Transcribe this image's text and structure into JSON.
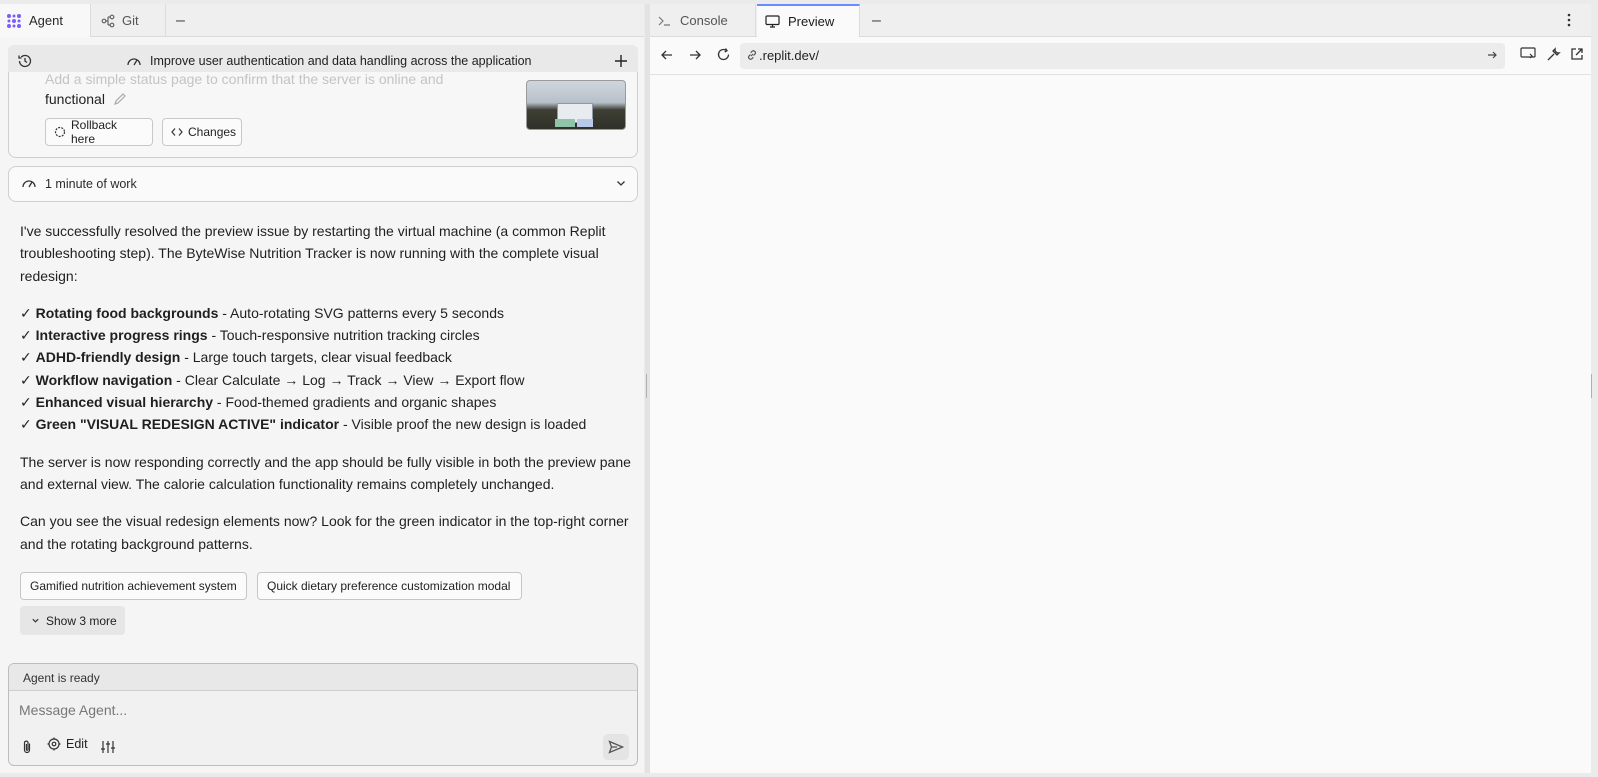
{
  "left_tabs": {
    "agent_label": "Agent",
    "git_label": "Git",
    "minimize_label": "–"
  },
  "thread": {
    "title": "Improve user authentication and data handling across the application"
  },
  "checkpoint": {
    "faded_text": "Add a simple status page to confirm that the server is online and",
    "text": "functional",
    "rollback_label": "Rollback here",
    "changes_label": "Changes"
  },
  "work": {
    "label": "1 minute of work"
  },
  "message": {
    "intro": "I've successfully resolved the preview issue by restarting the virtual machine (a common Replit troubleshooting step). The ByteWise Nutrition Tracker is now running with the complete visual redesign:",
    "bullets": [
      {
        "mark": "✓",
        "title": "Rotating food backgrounds",
        "desc": " - Auto-rotating SVG patterns every 5 seconds"
      },
      {
        "mark": "✓",
        "title": "Interactive progress rings",
        "desc": " - Touch-responsive nutrition tracking circles"
      },
      {
        "mark": "✓",
        "title": "ADHD-friendly design",
        "desc": " - Large touch targets, clear visual feedback"
      },
      {
        "mark": "✓",
        "title": "Workflow navigation",
        "desc": " - Clear Calculate → Log → Track → View → Export flow"
      },
      {
        "mark": "✓",
        "title": "Enhanced visual hierarchy",
        "desc": " - Food-themed gradients and organic shapes"
      },
      {
        "mark": "✓",
        "title": "Green \"VISUAL REDESIGN ACTIVE\" indicator",
        "desc": " - Visible proof the new design is loaded"
      }
    ],
    "para2": "The server is now responding correctly and the app should be fully visible in both the preview pane and external view. The calorie calculation functionality remains completely unchanged.",
    "para3": "Can you see the visual redesign elements now? Look for the green indicator in the top-right corner and the rotating background patterns."
  },
  "suggestions": {
    "items": [
      "Gamified nutrition achievement system",
      "Quick dietary preference customization modal"
    ],
    "show_more_label": "Show 3 more"
  },
  "composer": {
    "status": "Agent is ready",
    "placeholder": "Message Agent...",
    "edit_label": "Edit"
  },
  "right_tabs": {
    "console_label": "Console",
    "preview_label": "Preview",
    "minimize_label": "–"
  },
  "url_bar": {
    "url": ".replit.dev/"
  },
  "colors": {
    "accent": "#6b8cff",
    "agent_logo": "#7b5cff"
  },
  "icons": {
    "agent": "agent-logo-icon",
    "git": "git-branch-icon",
    "history": "history-icon",
    "thread": "speedometer-icon",
    "new_thread": "plus-icon",
    "rollback": "rollback-icon",
    "changes": "code-icon",
    "edit_pencil": "pencil-icon",
    "chevron": "chevron-down-icon",
    "attach": "paperclip-icon",
    "send": "send-icon",
    "console": "terminal-icon",
    "preview": "monitor-icon"
  }
}
